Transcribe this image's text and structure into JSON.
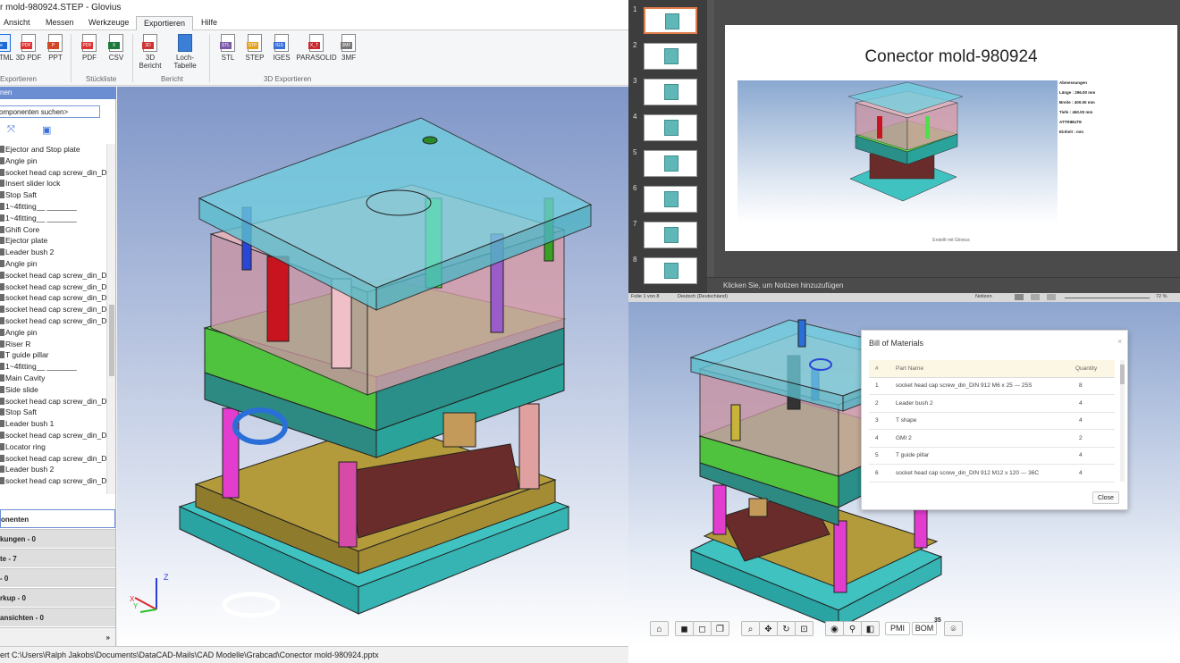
{
  "app": {
    "window_title": "r mold-980924.STEP - Glovius",
    "menu": [
      "Ansicht",
      "Messen",
      "Werkzeuge",
      "Exportieren",
      "Hilfe"
    ],
    "active_menu": "Exportieren",
    "ribbon": {
      "buttons": [
        {
          "label": "HTML",
          "icon": "html-icon"
        },
        {
          "label": "3D PDF",
          "icon": "pdf-3d-icon"
        },
        {
          "label": "PPT",
          "icon": "ppt-icon"
        },
        {
          "label": "PDF",
          "icon": "pdf-icon"
        },
        {
          "label": "CSV",
          "icon": "csv-icon"
        },
        {
          "label": "3D Bericht",
          "icon": "report-3d-icon"
        },
        {
          "label": "Loch-Tabelle",
          "icon": "hole-table-icon"
        },
        {
          "label": "STL",
          "icon": "stl-file-icon"
        },
        {
          "label": "STEP",
          "icon": "step-file-icon"
        },
        {
          "label": "IGES",
          "icon": "iges-file-icon"
        },
        {
          "label": "PARASOLID",
          "icon": "parasolid-file-icon"
        },
        {
          "label": "3MF",
          "icon": "3mf-file-icon"
        }
      ],
      "groups": [
        "Exportieren",
        "Stückliste",
        "Bericht",
        "3D Exportieren"
      ]
    },
    "panel": {
      "header": "nen",
      "search_value": "omponenten suchen>",
      "tree_items": [
        "Ejector and Stop  plate",
        "Angle pin",
        "socket head cap screw_din_DI",
        "Insert slider lock",
        "Stop Saft",
        "1~4fitting__ _______",
        "1~4fitting__ _______",
        "Ghifi Core",
        "Ejector plate",
        "Leader bush 2",
        "Angle pin",
        "socket head cap screw_din_DI",
        "socket head cap screw_din_DI",
        "socket head cap screw_din_DI",
        "socket head cap screw_din_DI",
        "socket head cap screw_din_DI",
        "Angle pin",
        "Riser R",
        "T guide pillar",
        "1~4fitting__ _______",
        "Main Cavity",
        "Side slide",
        "socket head cap screw_din_DI",
        "Stop Saft",
        "Leader bush 1",
        "socket head cap screw_din_DI",
        "Locator ring",
        "socket head cap screw_din_DI",
        "Leader bush 2",
        "socket head cap screw_din_DI"
      ],
      "accordion": [
        "onenten",
        "kungen - 0",
        "te - 7",
        "- 0",
        "rkup - 0",
        "ansichten - 0"
      ]
    },
    "status": "ert C:\\Users\\Ralph Jakobs\\Documents\\DataCAD-Mails\\CAD Modelle\\Grabcad\\Conector mold-980924.pptx"
  },
  "ppt": {
    "slide_numbers": [
      "1",
      "2",
      "3",
      "4",
      "5",
      "6",
      "7",
      "8"
    ],
    "slide_title": "Conector mold-980924",
    "properties": [
      "Abmessungen",
      "Länge : 296.00 mm",
      "Breite : 400.00 mm",
      "Tiefe : 460.00 mm",
      "ATTRIBUTE",
      "Einheit : mm"
    ],
    "credit": "Erstellt mit Glovius",
    "notes_placeholder": "Klicken Sie, um Notizen hinzuzufügen",
    "status_left": "Folie 1 von 8",
    "status_lang": "Deutsch (Deutschland)",
    "status_notes": "Notizen",
    "zoom": "72 %"
  },
  "bom": {
    "title": "Bill of Materials",
    "close_x": "×",
    "columns": [
      "#",
      "Part Name",
      "Quantity"
    ],
    "rows": [
      [
        "1",
        "socket head cap screw_din_DIN 912 M6 x 25 --- 25S",
        "8"
      ],
      [
        "2",
        "Leader bush 2",
        "4"
      ],
      [
        "3",
        "T shape",
        "4"
      ],
      [
        "4",
        "GMI 2",
        "2"
      ],
      [
        "5",
        "T guide pillar",
        "4"
      ],
      [
        "6",
        "socket head cap screw_din_DIN 912 M12 x 120 --- 36C",
        "4"
      ]
    ],
    "close_label": "Close"
  },
  "viewer_toolbar": {
    "pmi": "PMI",
    "bom": "BOM",
    "badge": "35"
  },
  "colors": {
    "ribbon_tab_active": "#f5f6f7",
    "panel_header": "#6b8ed2",
    "ppt_bg": "#4b4b4b",
    "ppt_thumb_selected": "#e37c4b"
  }
}
